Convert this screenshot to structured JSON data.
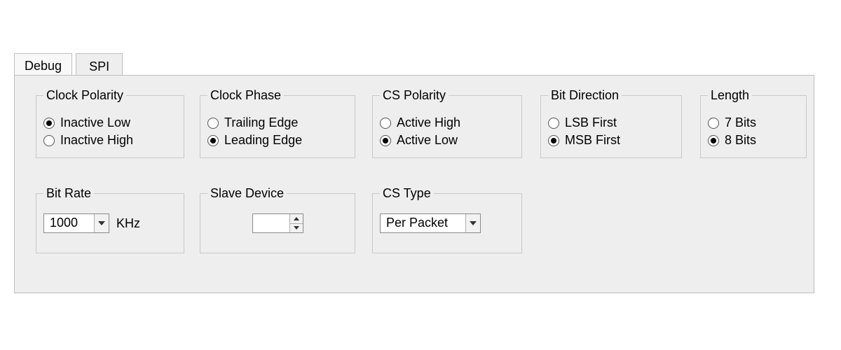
{
  "tabs": {
    "debug": "Debug",
    "spi": "SPI",
    "active": "spi"
  },
  "groups": {
    "clock_polarity": {
      "legend": "Clock Polarity",
      "options": [
        "Inactive Low",
        "Inactive High"
      ],
      "selected": "Inactive Low"
    },
    "clock_phase": {
      "legend": "Clock Phase",
      "options": [
        "Trailing Edge",
        "Leading Edge"
      ],
      "selected": "Leading Edge"
    },
    "cs_polarity": {
      "legend": "CS Polarity",
      "options": [
        "Active High",
        "Active Low"
      ],
      "selected": "Active Low"
    },
    "bit_direction": {
      "legend": "Bit Direction",
      "options": [
        "LSB First",
        "MSB First"
      ],
      "selected": "MSB First"
    },
    "length": {
      "legend": "Length",
      "options": [
        "7 Bits",
        "8 Bits"
      ],
      "selected": "8 Bits"
    },
    "bit_rate": {
      "legend": "Bit Rate",
      "value": "1000",
      "unit": "KHz"
    },
    "slave_device": {
      "legend": "Slave Device",
      "value": ""
    },
    "cs_type": {
      "legend": "CS Type",
      "value": "Per Packet"
    }
  }
}
